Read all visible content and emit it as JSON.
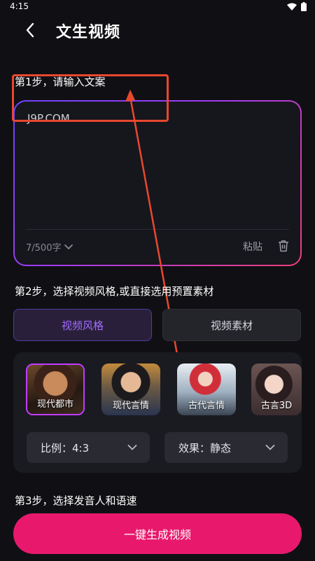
{
  "status": {
    "time": "4:15"
  },
  "header": {
    "title": "文生视频"
  },
  "step1": {
    "title": "第1步，请输入文案",
    "text_value": "J9P.COM",
    "char_count": "7/500字",
    "paste_label": "粘贴"
  },
  "step2": {
    "title": "第2步，选择视频风格,或直接选用预置素材",
    "tabs": [
      {
        "label": "视频风格"
      },
      {
        "label": "视频素材"
      }
    ],
    "styles": [
      {
        "label": "现代都市"
      },
      {
        "label": "现代言情"
      },
      {
        "label": "古代言情"
      },
      {
        "label": "古言3D"
      }
    ],
    "ratio": {
      "label": "比例：4:3"
    },
    "effect": {
      "label": "效果：静态"
    }
  },
  "step3": {
    "title": "第3步，选择发音人和语速"
  },
  "generate_button": {
    "label": "一键生成视频"
  },
  "colors": {
    "accent": "#e8196d",
    "tab_active_text": "#a06cff",
    "annotation": "#e8482e"
  }
}
